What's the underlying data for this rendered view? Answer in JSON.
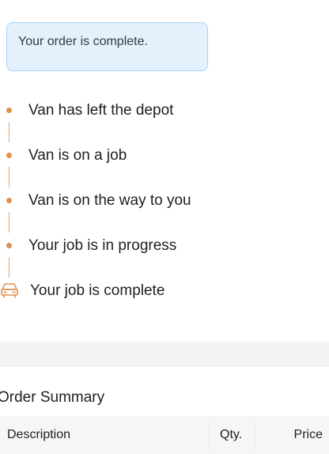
{
  "alert": {
    "message": "Your order is complete."
  },
  "timeline": {
    "steps": [
      {
        "label": "Van has left the depot",
        "icon": "dot"
      },
      {
        "label": "Van is on a job",
        "icon": "dot"
      },
      {
        "label": "Van is on the way to you",
        "icon": "dot"
      },
      {
        "label": "Your job is in progress",
        "icon": "dot"
      },
      {
        "label": "Your job is complete",
        "icon": "van-icon"
      }
    ],
    "accent_color": "#e2904d"
  },
  "order_summary": {
    "title": "Order Summary",
    "columns": {
      "description": "Description",
      "qty": "Qty.",
      "price": "Price"
    }
  }
}
